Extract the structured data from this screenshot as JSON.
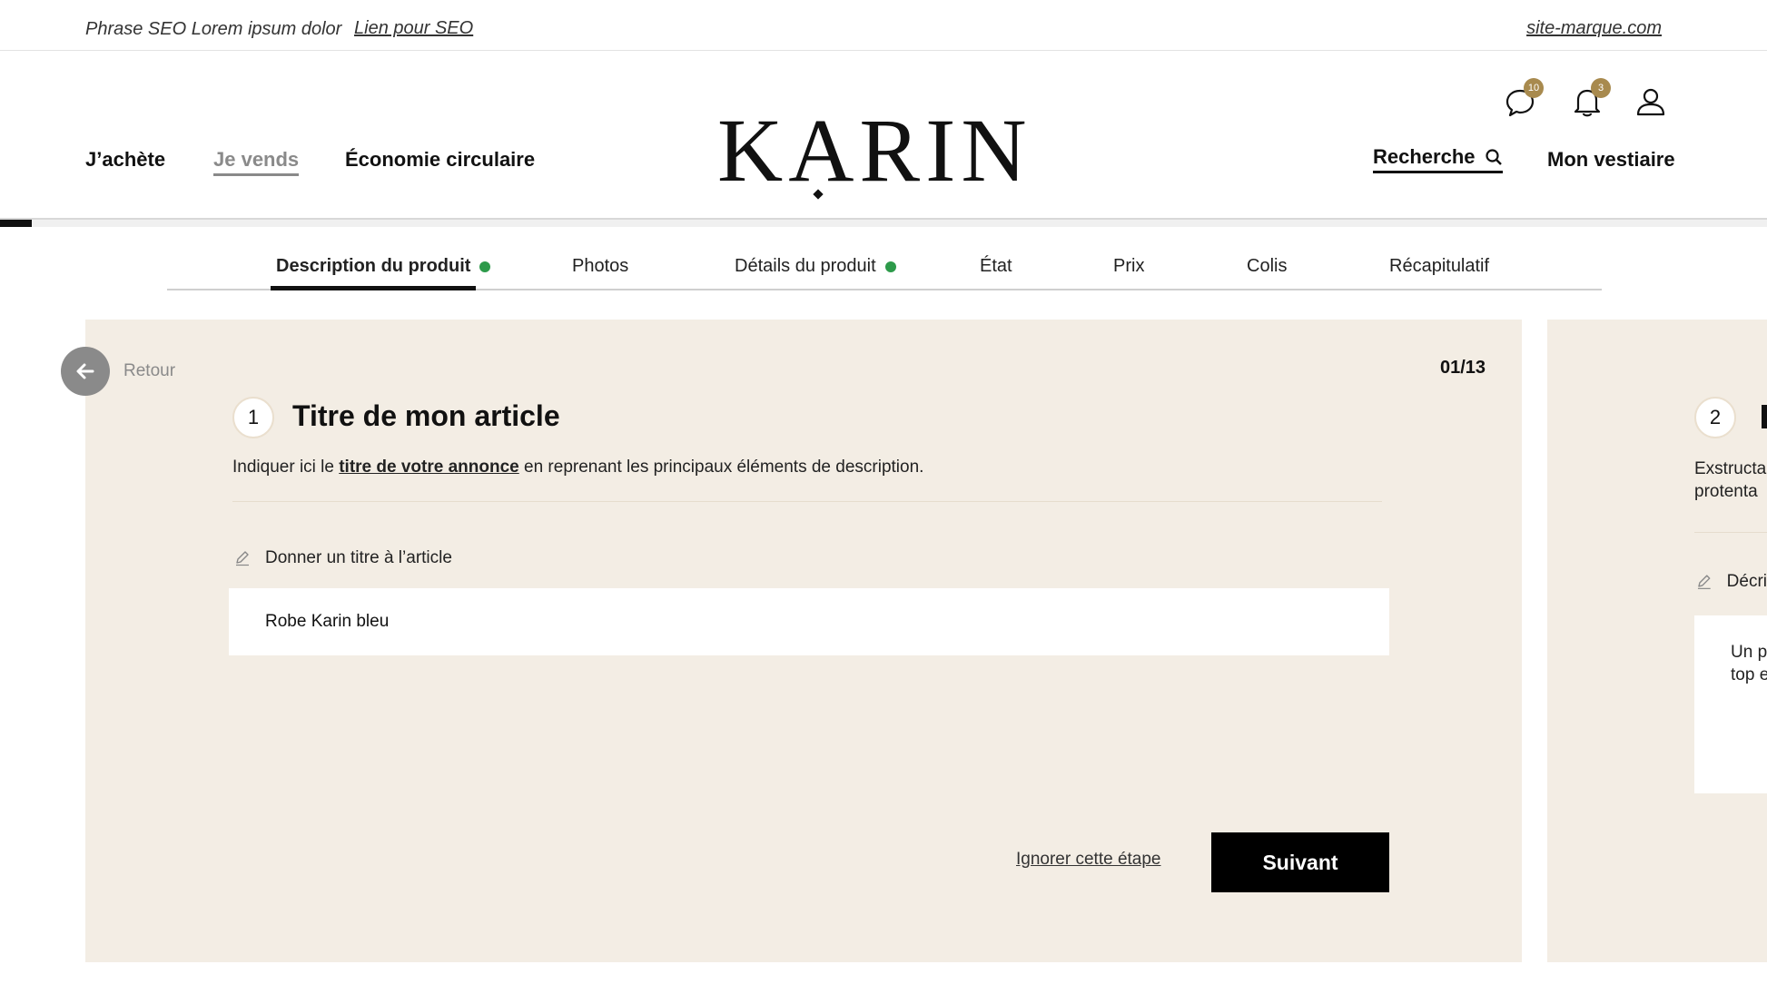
{
  "seo_bar": {
    "phrase": "Phrase SEO Lorem ipsum dolor",
    "link": "Lien pour SEO",
    "site_link": "site-marque.com"
  },
  "nav": {
    "buy": "J’achète",
    "sell": "Je vends",
    "circular": "Économie circulaire",
    "search": "Recherche",
    "wardrobe": "Mon vestiaire"
  },
  "logo": "KARIN",
  "header_icons": {
    "messages_badge": "10",
    "notifications_badge": "3"
  },
  "progress": {
    "value": 0.018
  },
  "steps": [
    {
      "label": "Description du produit",
      "done": true,
      "active": true
    },
    {
      "label": "Photos",
      "done": false,
      "active": false
    },
    {
      "label": "Détails du produit",
      "done": true,
      "active": false
    },
    {
      "label": "État",
      "done": false,
      "active": false
    },
    {
      "label": "Prix",
      "done": false,
      "active": false
    },
    {
      "label": "Colis",
      "done": false,
      "active": false
    },
    {
      "label": "Récapitulatif",
      "done": false,
      "active": false
    }
  ],
  "form": {
    "back_label": "Retour",
    "counter": "01/13",
    "step_number": "1",
    "title": "Titre de mon article",
    "instruction_before": "Indiquer ici le ",
    "instruction_emphasis": "titre de votre annonce",
    "instruction_after": " en reprenant les principaux éléments de description.",
    "field_label": "Donner un titre à l’article",
    "field_value": "Robe Karin bleu",
    "skip_label": "Ignorer cette étape",
    "next_label": "Suivant"
  },
  "next_card": {
    "step_number": "2",
    "text_line1": "Exstructa",
    "text_line2": "protenta",
    "field_label": "Décri",
    "field_value_line1": "Un p",
    "field_value_line2": "top e"
  },
  "colors": {
    "card_background": "#f3ede4",
    "accent_badge": "#a88a4e",
    "check_green": "#2d9a4a",
    "primary_button": "#000000"
  }
}
